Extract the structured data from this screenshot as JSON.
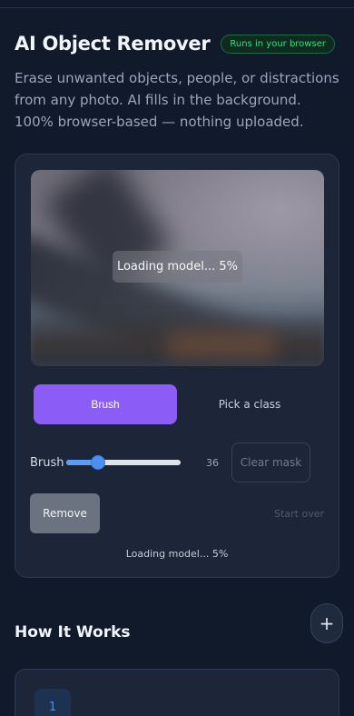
{
  "header": {
    "title": "AI Object Remover",
    "badge": "Runs in your browser",
    "description": "Erase unwanted objects, people, or distractions from any photo. AI fills in the background. 100% browser-based — nothing uploaded."
  },
  "editor": {
    "canvas_overlay": "Loading model... 5%",
    "modes": [
      "Brush",
      "Pick a class"
    ],
    "active_mode": "Brush",
    "brush_label": "Brush",
    "brush_size": 36,
    "brush_fraction": 0.28,
    "clear_mask_label": "Clear mask",
    "remove_label": "Remove",
    "start_over_label": "Start over",
    "status": "Loading model... 5%"
  },
  "how_it_works": {
    "title": "How It Works",
    "expand_icon": "plus-icon",
    "first_step_number": "1"
  },
  "colors": {
    "accent": "#8b5cf6",
    "badge_green": "#3ddc84",
    "slider_blue": "#4a90f0"
  }
}
